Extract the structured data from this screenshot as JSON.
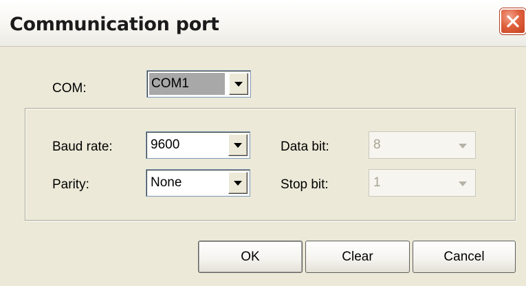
{
  "window": {
    "title": "Communication port"
  },
  "com": {
    "label": "COM:",
    "value": "COM1"
  },
  "settings": {
    "baud_rate": {
      "label": "Baud rate:",
      "value": "9600"
    },
    "parity": {
      "label": "Parity:",
      "value": "None"
    },
    "data_bit": {
      "label": "Data bit:",
      "value": "8",
      "enabled": false
    },
    "stop_bit": {
      "label": "Stop bit:",
      "value": "1",
      "enabled": false
    }
  },
  "buttons": {
    "ok": "OK",
    "clear": "Clear",
    "cancel": "Cancel"
  },
  "icons": {
    "close": "close-icon",
    "dropdown": "chevron-down-icon"
  },
  "colors": {
    "dialog_bg": "#ece9d8",
    "close_button": "#e0623f"
  }
}
